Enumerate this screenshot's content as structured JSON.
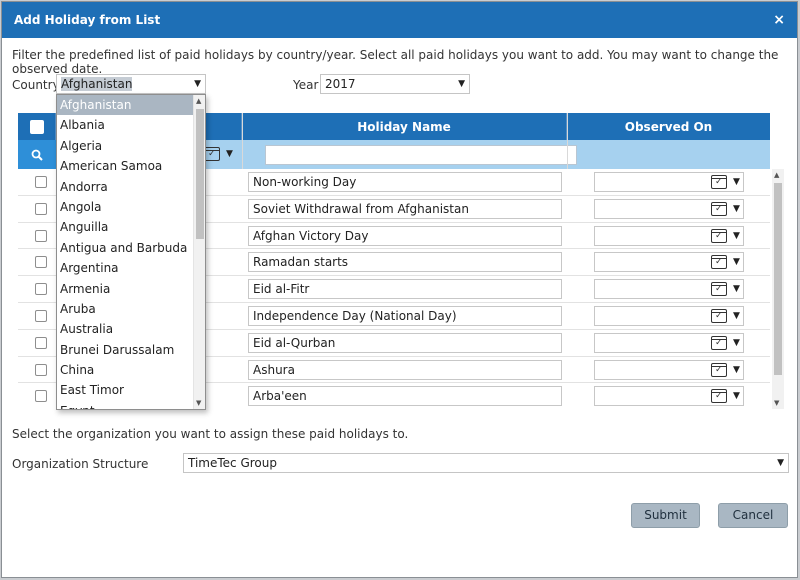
{
  "dialog": {
    "title": "Add Holiday from List",
    "close_symbol": "×"
  },
  "instruction": "Filter the predefined list of paid holidays by country/year. Select all paid holidays you want to add. You may want to change the observed date.",
  "filters": {
    "country_label": "Country",
    "country_value": "Afghanistan",
    "year_label": "Year",
    "year_value": "2017"
  },
  "table": {
    "columns": [
      "Holiday Name",
      "Observed On"
    ],
    "rows": [
      {
        "holiday_name": "Non-working Day"
      },
      {
        "holiday_name": "Soviet Withdrawal from Afghanistan"
      },
      {
        "holiday_name": "Afghan Victory Day"
      },
      {
        "holiday_name": "Ramadan starts"
      },
      {
        "holiday_name": "Eid al-Fitr"
      },
      {
        "holiday_name": "Independence Day (National Day)"
      },
      {
        "holiday_name": "Eid al-Qurban"
      },
      {
        "holiday_name": "Ashura"
      },
      {
        "holiday_name": "Arba'een"
      }
    ]
  },
  "country_dropdown": {
    "options": [
      "Afghanistan",
      "Albania",
      "Algeria",
      "American Samoa",
      "Andorra",
      "Angola",
      "Anguilla",
      "Antigua and Barbuda",
      "Argentina",
      "Armenia",
      "Aruba",
      "Australia",
      "Brunei Darussalam",
      "China",
      "East Timor",
      "Egypt"
    ],
    "selected_index": 0
  },
  "organization": {
    "prompt": "Select the organization you want to assign these paid holidays to.",
    "label": "Organization Structure",
    "value": "TimeTec Group"
  },
  "buttons": {
    "submit": "Submit",
    "cancel": "Cancel"
  },
  "colors": {
    "header_blue": "#1e6fb6",
    "filter_row": "#a6d1ef",
    "button": "#a9b7c3"
  },
  "icons": [
    "close-icon",
    "search-icon",
    "calendar-icon",
    "chevron-down-icon"
  ]
}
